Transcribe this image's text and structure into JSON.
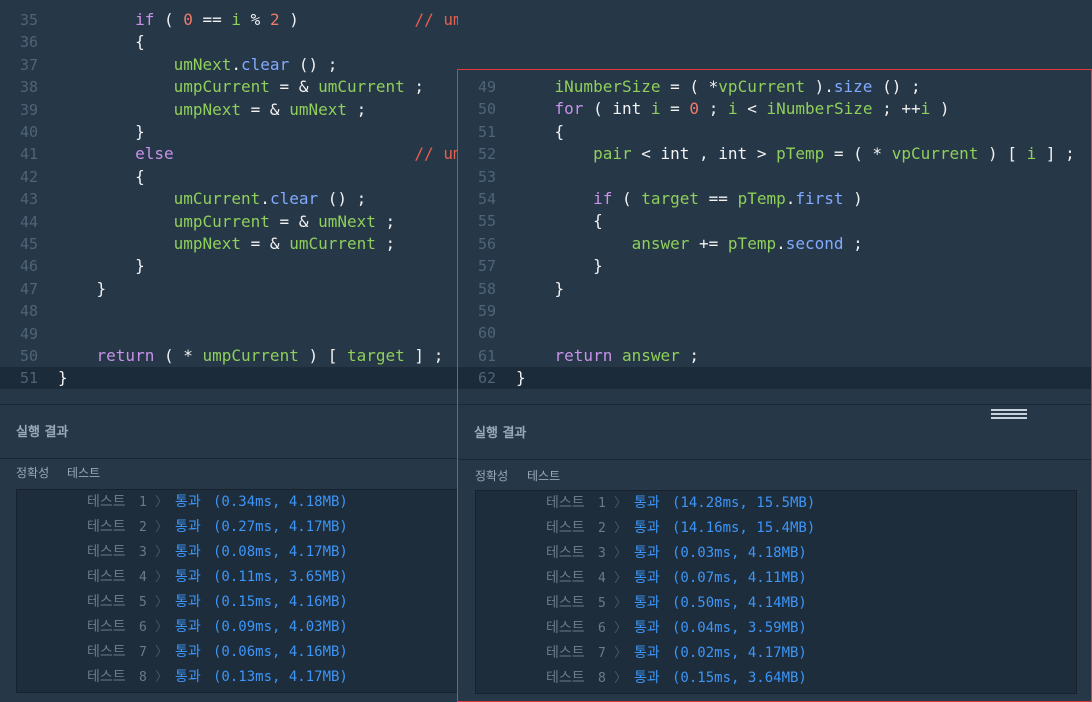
{
  "left": {
    "lines": [
      {
        "n": "35",
        "active": false,
        "tokens": [
          {
            "t": "        ",
            "c": "op"
          },
          {
            "t": "if",
            "c": "kw"
          },
          {
            "t": " ( ",
            "c": "op"
          },
          {
            "t": "0",
            "c": "num"
          },
          {
            "t": " == ",
            "c": "op"
          },
          {
            "t": "i",
            "c": "id"
          },
          {
            "t": " % ",
            "c": "op"
          },
          {
            "t": "2",
            "c": "num"
          },
          {
            "t": " )            ",
            "c": "op"
          },
          {
            "t": "// umpCurrent -> umNext",
            "c": "cm"
          }
        ]
      },
      {
        "n": "36",
        "active": false,
        "tokens": [
          {
            "t": "        {",
            "c": "op"
          }
        ]
      },
      {
        "n": "37",
        "active": false,
        "tokens": [
          {
            "t": "            ",
            "c": "op"
          },
          {
            "t": "umNext",
            "c": "id"
          },
          {
            "t": ".",
            "c": "op"
          },
          {
            "t": "clear",
            "c": "fn"
          },
          {
            "t": " () ;",
            "c": "op"
          }
        ]
      },
      {
        "n": "38",
        "active": false,
        "tokens": [
          {
            "t": "            ",
            "c": "op"
          },
          {
            "t": "umpCurrent",
            "c": "id"
          },
          {
            "t": " = & ",
            "c": "op"
          },
          {
            "t": "umCurrent",
            "c": "id"
          },
          {
            "t": " ;",
            "c": "op"
          }
        ]
      },
      {
        "n": "39",
        "active": false,
        "tokens": [
          {
            "t": "            ",
            "c": "op"
          },
          {
            "t": "umpNext",
            "c": "id"
          },
          {
            "t": " = & ",
            "c": "op"
          },
          {
            "t": "umNext",
            "c": "id"
          },
          {
            "t": " ;",
            "c": "op"
          }
        ]
      },
      {
        "n": "40",
        "active": false,
        "tokens": [
          {
            "t": "        }",
            "c": "op"
          }
        ]
      },
      {
        "n": "41",
        "active": false,
        "tokens": [
          {
            "t": "        ",
            "c": "op"
          },
          {
            "t": "else",
            "c": "kw"
          },
          {
            "t": "                         ",
            "c": "op"
          },
          {
            "t": "// ump",
            "c": "cm"
          }
        ]
      },
      {
        "n": "42",
        "active": false,
        "tokens": [
          {
            "t": "        {",
            "c": "op"
          }
        ]
      },
      {
        "n": "43",
        "active": false,
        "tokens": [
          {
            "t": "            ",
            "c": "op"
          },
          {
            "t": "umCurrent",
            "c": "id"
          },
          {
            "t": ".",
            "c": "op"
          },
          {
            "t": "clear",
            "c": "fn"
          },
          {
            "t": " () ;",
            "c": "op"
          }
        ]
      },
      {
        "n": "44",
        "active": false,
        "tokens": [
          {
            "t": "            ",
            "c": "op"
          },
          {
            "t": "umpCurrent",
            "c": "id"
          },
          {
            "t": " = & ",
            "c": "op"
          },
          {
            "t": "umNext",
            "c": "id"
          },
          {
            "t": " ;",
            "c": "op"
          }
        ]
      },
      {
        "n": "45",
        "active": false,
        "tokens": [
          {
            "t": "            ",
            "c": "op"
          },
          {
            "t": "umpNext",
            "c": "id"
          },
          {
            "t": " = & ",
            "c": "op"
          },
          {
            "t": "umCurrent",
            "c": "id"
          },
          {
            "t": " ;",
            "c": "op"
          }
        ]
      },
      {
        "n": "46",
        "active": false,
        "tokens": [
          {
            "t": "        }",
            "c": "op"
          }
        ]
      },
      {
        "n": "47",
        "active": false,
        "tokens": [
          {
            "t": "    }",
            "c": "op"
          }
        ]
      },
      {
        "n": "48",
        "active": false,
        "tokens": []
      },
      {
        "n": "49",
        "active": false,
        "tokens": []
      },
      {
        "n": "50",
        "active": false,
        "tokens": [
          {
            "t": "    ",
            "c": "op"
          },
          {
            "t": "return",
            "c": "kw"
          },
          {
            "t": " ( * ",
            "c": "op"
          },
          {
            "t": "umpCurrent",
            "c": "id"
          },
          {
            "t": " ) [ ",
            "c": "op"
          },
          {
            "t": "target",
            "c": "id"
          },
          {
            "t": " ] ;",
            "c": "op"
          }
        ]
      },
      {
        "n": "51",
        "active": true,
        "tokens": [
          {
            "t": "}",
            "c": "op"
          }
        ]
      }
    ],
    "result_header": "실행 결과",
    "tabs": [
      "정확성",
      "테스트"
    ],
    "rows": [
      {
        "label": "테스트",
        "num": "1",
        "chev": "〉",
        "pass": "통과",
        "stat": "(0.34ms, 4.18MB)"
      },
      {
        "label": "테스트",
        "num": "2",
        "chev": "〉",
        "pass": "통과",
        "stat": "(0.27ms, 4.17MB)"
      },
      {
        "label": "테스트",
        "num": "3",
        "chev": "〉",
        "pass": "통과",
        "stat": "(0.08ms, 4.17MB)"
      },
      {
        "label": "테스트",
        "num": "4",
        "chev": "〉",
        "pass": "통과",
        "stat": "(0.11ms, 3.65MB)"
      },
      {
        "label": "테스트",
        "num": "5",
        "chev": "〉",
        "pass": "통과",
        "stat": "(0.15ms, 4.16MB)"
      },
      {
        "label": "테스트",
        "num": "6",
        "chev": "〉",
        "pass": "통과",
        "stat": "(0.09ms, 4.03MB)"
      },
      {
        "label": "테스트",
        "num": "7",
        "chev": "〉",
        "pass": "통과",
        "stat": "(0.06ms, 4.16MB)"
      },
      {
        "label": "테스트",
        "num": "8",
        "chev": "〉",
        "pass": "통과",
        "stat": "(0.13ms, 4.17MB)"
      }
    ]
  },
  "right": {
    "lines": [
      {
        "n": "49",
        "active": false,
        "tokens": [
          {
            "t": "    ",
            "c": "op"
          },
          {
            "t": "iNumberSize",
            "c": "id"
          },
          {
            "t": " = ( *",
            "c": "op"
          },
          {
            "t": "vpCurrent",
            "c": "id"
          },
          {
            "t": " ).",
            "c": "op"
          },
          {
            "t": "size",
            "c": "fn"
          },
          {
            "t": " () ;",
            "c": "op"
          }
        ]
      },
      {
        "n": "50",
        "active": false,
        "tokens": [
          {
            "t": "    ",
            "c": "op"
          },
          {
            "t": "for",
            "c": "kw"
          },
          {
            "t": " ( int ",
            "c": "op"
          },
          {
            "t": "i",
            "c": "id"
          },
          {
            "t": " = ",
            "c": "op"
          },
          {
            "t": "0",
            "c": "num"
          },
          {
            "t": " ; ",
            "c": "op"
          },
          {
            "t": "i",
            "c": "id"
          },
          {
            "t": " < ",
            "c": "op"
          },
          {
            "t": "iNumberSize",
            "c": "id"
          },
          {
            "t": " ; ++",
            "c": "op"
          },
          {
            "t": "i",
            "c": "id"
          },
          {
            "t": " )",
            "c": "op"
          }
        ]
      },
      {
        "n": "51",
        "active": false,
        "tokens": [
          {
            "t": "    {",
            "c": "op"
          }
        ]
      },
      {
        "n": "52",
        "active": false,
        "tokens": [
          {
            "t": "        ",
            "c": "op"
          },
          {
            "t": "pair",
            "c": "id"
          },
          {
            "t": " < int , int > ",
            "c": "op"
          },
          {
            "t": "pTemp",
            "c": "id"
          },
          {
            "t": " = ( * ",
            "c": "op"
          },
          {
            "t": "vpCurrent",
            "c": "id"
          },
          {
            "t": " ) [ ",
            "c": "op"
          },
          {
            "t": "i",
            "c": "id"
          },
          {
            "t": " ] ;",
            "c": "op"
          }
        ]
      },
      {
        "n": "53",
        "active": false,
        "tokens": []
      },
      {
        "n": "54",
        "active": false,
        "tokens": [
          {
            "t": "        ",
            "c": "op"
          },
          {
            "t": "if",
            "c": "kw"
          },
          {
            "t": " ( ",
            "c": "op"
          },
          {
            "t": "target",
            "c": "id"
          },
          {
            "t": " == ",
            "c": "op"
          },
          {
            "t": "pTemp",
            "c": "id"
          },
          {
            "t": ".",
            "c": "op"
          },
          {
            "t": "first",
            "c": "fn"
          },
          {
            "t": " )",
            "c": "op"
          }
        ]
      },
      {
        "n": "55",
        "active": false,
        "tokens": [
          {
            "t": "        {",
            "c": "op"
          }
        ]
      },
      {
        "n": "56",
        "active": false,
        "tokens": [
          {
            "t": "            ",
            "c": "op"
          },
          {
            "t": "answer",
            "c": "id"
          },
          {
            "t": " += ",
            "c": "op"
          },
          {
            "t": "pTemp",
            "c": "id"
          },
          {
            "t": ".",
            "c": "op"
          },
          {
            "t": "second",
            "c": "fn"
          },
          {
            "t": " ;",
            "c": "op"
          }
        ]
      },
      {
        "n": "57",
        "active": false,
        "tokens": [
          {
            "t": "        }",
            "c": "op"
          }
        ]
      },
      {
        "n": "58",
        "active": false,
        "tokens": [
          {
            "t": "    }",
            "c": "op"
          }
        ]
      },
      {
        "n": "59",
        "active": false,
        "tokens": []
      },
      {
        "n": "60",
        "active": false,
        "tokens": []
      },
      {
        "n": "61",
        "active": false,
        "tokens": [
          {
            "t": "    ",
            "c": "op"
          },
          {
            "t": "return",
            "c": "kw"
          },
          {
            "t": " ",
            "c": "op"
          },
          {
            "t": "answer",
            "c": "id"
          },
          {
            "t": " ;",
            "c": "op"
          }
        ]
      },
      {
        "n": "62",
        "active": true,
        "tokens": [
          {
            "t": "}",
            "c": "op"
          }
        ]
      }
    ],
    "result_header": "실행 결과",
    "tabs": [
      "정확성",
      "테스트"
    ],
    "rows": [
      {
        "label": "테스트",
        "num": "1",
        "chev": "〉",
        "pass": "통과",
        "stat": "(14.28ms, 15.5MB)"
      },
      {
        "label": "테스트",
        "num": "2",
        "chev": "〉",
        "pass": "통과",
        "stat": "(14.16ms, 15.4MB)"
      },
      {
        "label": "테스트",
        "num": "3",
        "chev": "〉",
        "pass": "통과",
        "stat": "(0.03ms, 4.18MB)"
      },
      {
        "label": "테스트",
        "num": "4",
        "chev": "〉",
        "pass": "통과",
        "stat": "(0.07ms, 4.11MB)"
      },
      {
        "label": "테스트",
        "num": "5",
        "chev": "〉",
        "pass": "통과",
        "stat": "(0.50ms, 4.14MB)"
      },
      {
        "label": "테스트",
        "num": "6",
        "chev": "〉",
        "pass": "통과",
        "stat": "(0.04ms, 3.59MB)"
      },
      {
        "label": "테스트",
        "num": "7",
        "chev": "〉",
        "pass": "통과",
        "stat": "(0.02ms, 4.17MB)"
      },
      {
        "label": "테스트",
        "num": "8",
        "chev": "〉",
        "pass": "통과",
        "stat": "(0.15ms, 3.64MB)"
      }
    ]
  }
}
